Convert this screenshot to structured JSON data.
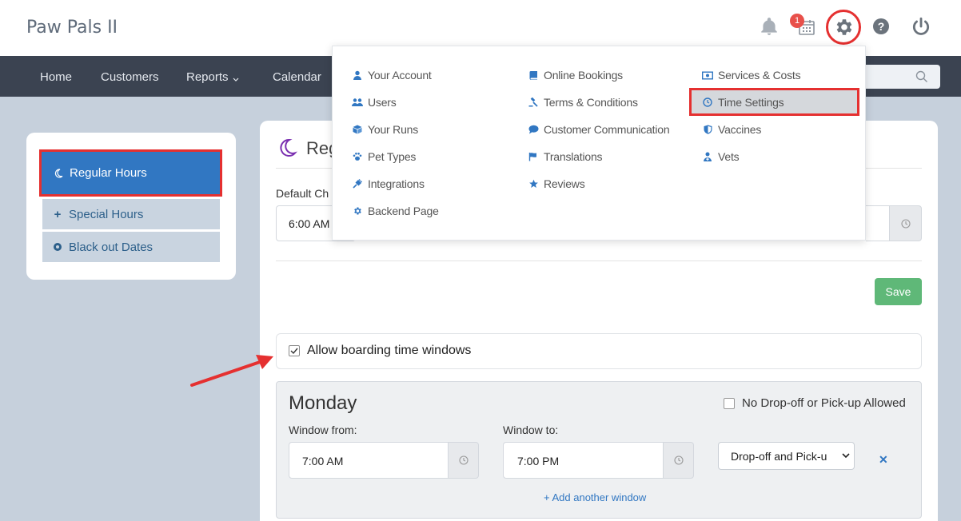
{
  "app": {
    "title": "Paw Pals II",
    "notification_count": "1"
  },
  "top_icons": [
    "bell-icon",
    "calendar-icon",
    "gear-icon",
    "help-icon",
    "power-icon"
  ],
  "nav": {
    "items": [
      "Home",
      "Customers",
      "Reports",
      "Calendar"
    ]
  },
  "settings_menu": {
    "col1": [
      "Your Account",
      "Users",
      "Your Runs",
      "Pet Types",
      "Integrations",
      "Backend Page"
    ],
    "col2": [
      "Online Bookings",
      "Terms & Conditions",
      "Customer Communication",
      "Translations",
      "Reviews"
    ],
    "col3": [
      "Services & Costs",
      "Time Settings",
      "Vaccines",
      "Vets"
    ],
    "highlighted": "Time Settings"
  },
  "sidebar": {
    "active": "Regular Hours",
    "items": [
      "Special Hours",
      "Black out Dates"
    ]
  },
  "main": {
    "title_partial": "Reg",
    "default_label_partial": "Default Ch",
    "default_value": "6:00 AM",
    "save_label": "Save",
    "allow_label": "Allow boarding time windows",
    "allow_checked": true
  },
  "monday": {
    "day": "Monday",
    "no_drop_label": "No Drop-off or Pick-up Allowed",
    "window_from_label": "Window from:",
    "window_from_value": "7:00 AM",
    "window_to_label": "Window to:",
    "window_to_value": "7:00 PM",
    "type_value": "Drop-off and Pick-u",
    "add_window": "+ Add another window"
  },
  "colors": {
    "accent": "#3177c2",
    "highlight": "#e53030",
    "nav_bg": "#3b4351",
    "save": "#5fb878"
  }
}
